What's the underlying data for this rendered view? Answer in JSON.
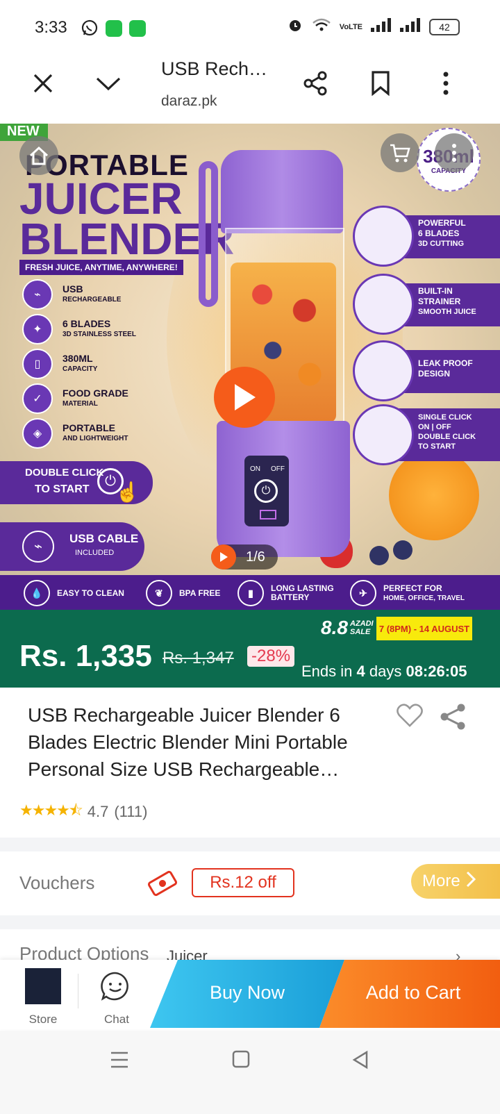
{
  "status_bar": {
    "time": "3:33",
    "battery": "42",
    "network_label": "VoLTE"
  },
  "browser": {
    "title": "USB Rech…",
    "domain": "daraz.pk"
  },
  "hero": {
    "new_tag": "NEW",
    "title_line1": "PORTABLE",
    "title_line2": "JUICER",
    "title_line3": "BLENDER",
    "tagline": "FRESH JUICE, ANYTIME, ANYWHERE!",
    "capacity_value": "380ml",
    "capacity_label": "CAPACITY",
    "features": [
      {
        "title": "USB",
        "sub": "RECHARGEABLE",
        "icon": "usb-icon"
      },
      {
        "title": "6 BLADES",
        "sub": "3D STAINLESS STEEL",
        "icon": "blades-icon"
      },
      {
        "title": "380ML",
        "sub": "CAPACITY",
        "icon": "cup-icon"
      },
      {
        "title": "FOOD GRADE",
        "sub": "MATERIAL",
        "icon": "shield-icon"
      },
      {
        "title": "PORTABLE",
        "sub": "AND LIGHTWEIGHT",
        "icon": "bottle-icon"
      }
    ],
    "right_features": [
      {
        "line1": "POWERFUL",
        "line2": "6 BLADES",
        "line3": "3D CUTTING"
      },
      {
        "line1": "BUILT-IN",
        "line2": "STRAINER",
        "line3": "SMOOTH JUICE"
      },
      {
        "line1": "LEAK PROOF",
        "line2": "DESIGN",
        "line3": ""
      },
      {
        "line1": "SINGLE CLICK",
        "line2": "ON | OFF",
        "line3": "DOUBLE CLICK TO START"
      }
    ],
    "double_click_line1": "DOUBLE CLICK",
    "double_click_line2": "TO START",
    "usb_cable_title": "USB CABLE",
    "usb_cable_sub": "INCLUDED",
    "panel_on": "ON",
    "panel_off": "OFF",
    "bottom_strip": [
      {
        "label": "EASY TO CLEAN",
        "sub": ""
      },
      {
        "label": "BPA FREE",
        "sub": ""
      },
      {
        "label": "LONG LASTING",
        "sub": "BATTERY"
      },
      {
        "label": "PERFECT FOR",
        "sub": "HOME, OFFICE, TRAVEL"
      }
    ],
    "media_counter": "1/6"
  },
  "price": {
    "current": "Rs. 1,335",
    "original": "Rs. 1,347",
    "discount": "-28%",
    "sale_logo": "8.8",
    "sale_sub_line1": "AZADI",
    "sale_sub_line2": "SALE",
    "sale_dates": "7 (8PM) - 14 AUGUST",
    "ends_prefix": "Ends in ",
    "ends_days": "4",
    "ends_days_label": " days ",
    "ends_time": "08:26:05"
  },
  "product": {
    "title": "USB Rechargeable Juicer Blender 6 Blades Electric Blender Mini Portable Personal Size USB Rechargeable…",
    "rating": "4.7",
    "reviews": "(111)"
  },
  "vouchers": {
    "label": "Vouchers",
    "chip": "Rs.12 off",
    "more": "More"
  },
  "options": {
    "label": "Product Options",
    "value": "Juicer"
  },
  "action_bar": {
    "store_label": "Store",
    "chat_label": "Chat",
    "buy_now": "Buy Now",
    "add_to_cart": "Add to Cart"
  },
  "colors": {
    "price_bar": "#0c6b4e",
    "buy_now": "#29b6ea",
    "add_to_cart": "#f5701a",
    "accent_purple": "#5a2a9a"
  }
}
